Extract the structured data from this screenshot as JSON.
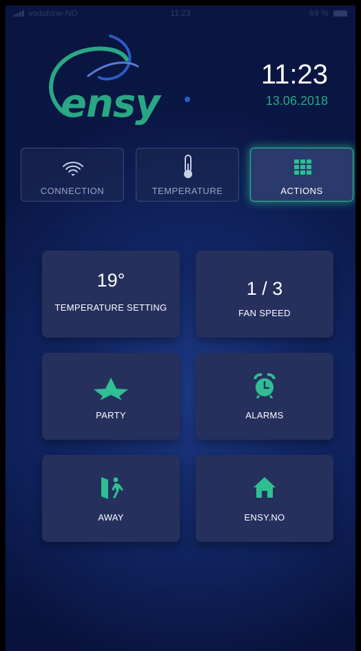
{
  "status_bar": {
    "carrier": "vodafone-NO",
    "time": "11:23",
    "battery_pct": "69 %"
  },
  "brand": {
    "logo_text": "ensy",
    "accent_color": "#2aa784"
  },
  "clock": {
    "time": "11:23",
    "date": "13.06.2018"
  },
  "tabs": [
    {
      "label": "CONNECTION",
      "icon": "wifi-icon",
      "active": false
    },
    {
      "label": "TEMPERATURE",
      "icon": "thermometer-icon",
      "active": false
    },
    {
      "label": "ACTIONS",
      "icon": "grid-icon",
      "active": true
    }
  ],
  "cards": {
    "temperature": {
      "value": "19°",
      "label": "TEMPERATURE SETTING"
    },
    "fan": {
      "value": "1 / 3",
      "label": "FAN SPEED"
    },
    "party": {
      "icon": "star-icon",
      "label": "PARTY"
    },
    "alarms": {
      "icon": "alarm-clock-icon",
      "label": "ALARMS"
    },
    "away": {
      "icon": "exit-person-icon",
      "label": "AWAY"
    },
    "ensy": {
      "icon": "home-icon",
      "label": "ENSY.NO"
    }
  }
}
